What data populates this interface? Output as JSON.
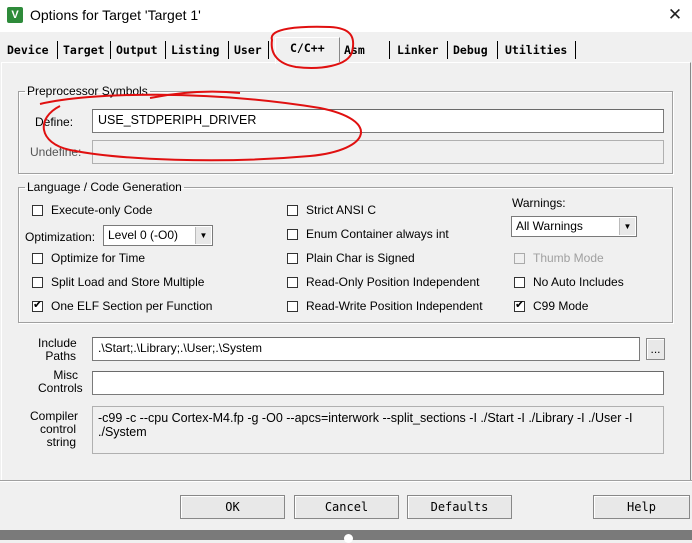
{
  "window": {
    "title": "Options for Target 'Target 1'",
    "app_icon": "keil-uvision-icon",
    "close_glyph": "✕"
  },
  "tabs": [
    {
      "label": "Device"
    },
    {
      "label": "Target"
    },
    {
      "label": "Output"
    },
    {
      "label": "Listing"
    },
    {
      "label": "User"
    },
    {
      "label": "C/C++",
      "active": true
    },
    {
      "label": "Asm"
    },
    {
      "label": "Linker"
    },
    {
      "label": "Debug"
    },
    {
      "label": "Utilities"
    }
  ],
  "preprocessor": {
    "legend": "Preprocessor Symbols",
    "define_label": "Define:",
    "define_value": "USE_STDPERIPH_DRIVER",
    "undefine_label": "Undefine:",
    "undefine_value": ""
  },
  "codegen": {
    "legend": "Language / Code Generation",
    "execute_only": {
      "label": "Execute-only Code",
      "checked": false
    },
    "optimization_label": "Optimization:",
    "optimization_value": "Level 0 (-O0)",
    "optimize_time": {
      "label": "Optimize for Time",
      "checked": false
    },
    "split_load": {
      "label": "Split Load and Store Multiple",
      "checked": false
    },
    "one_elf": {
      "label": "One ELF Section per Function",
      "checked": true
    },
    "strict_ansi": {
      "label": "Strict ANSI C",
      "checked": false
    },
    "enum_int": {
      "label": "Enum Container always int",
      "checked": false
    },
    "plain_char": {
      "label": "Plain Char is Signed",
      "checked": false
    },
    "ro_pi": {
      "label": "Read-Only Position Independent",
      "checked": false
    },
    "rw_pi": {
      "label": "Read-Write Position Independent",
      "checked": false
    },
    "warnings_label": "Warnings:",
    "warnings_value": "All Warnings",
    "thumb_mode": {
      "label": "Thumb Mode",
      "checked": false,
      "disabled": true
    },
    "no_auto_includes": {
      "label": "No Auto Includes",
      "checked": false
    },
    "c99_mode": {
      "label": "C99 Mode",
      "checked": true
    }
  },
  "include_paths": {
    "label_line1": "Include",
    "label_line2": "Paths",
    "value": ".\\Start;.\\Library;.\\User;.\\System",
    "browse_label": "..."
  },
  "misc_controls": {
    "label_line1": "Misc",
    "label_line2": "Controls",
    "value": ""
  },
  "compiler_string": {
    "label_line1": "Compiler",
    "label_line2": "control",
    "label_line3": "string",
    "value": "-c99 -c --cpu Cortex-M4.fp -g -O0 --apcs=interwork --split_sections -I ./Start -I ./Library -I ./User -I ./System"
  },
  "buttons": {
    "ok": "OK",
    "cancel": "Cancel",
    "defaults": "Defaults",
    "help": "Help"
  },
  "annotation_color": "#e01010"
}
